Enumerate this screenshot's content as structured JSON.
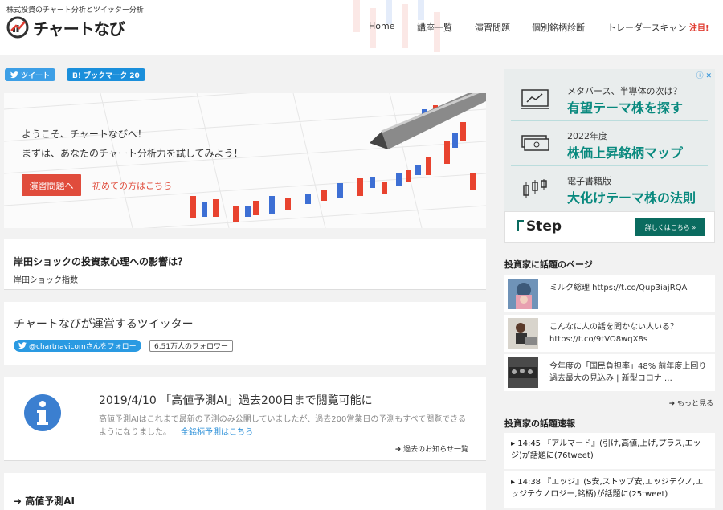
{
  "site": {
    "tagline": "株式投資のチャート分析とツイッター分析",
    "name": "チャートなび"
  },
  "nav": [
    "Home",
    "講座一覧",
    "演習問題",
    "個別銘柄診断",
    "トレーダースキャン"
  ],
  "nav_hot": "注目!",
  "share": {
    "tweet": "ツイート",
    "bookmark": "B! ブックマーク 20"
  },
  "hero": {
    "line1": "ようこそ、チャートなびへ！",
    "line2": "まずは、あなたのチャート分析力を試してみよう！",
    "cta": "演習問題へ",
    "link": "初めての方はこちら"
  },
  "card_kishida": {
    "title": "岸田ショックの投資家心理への影響は？",
    "link": "岸田ショック指数"
  },
  "card_twitter": {
    "title": "チャートなびが運営するツイッター",
    "follow": "@chartnavicomさんをフォロー",
    "followers": "6.51万人のフォロワー"
  },
  "notice": {
    "title": "2019/4/10 「高値予測AI」過去200日まで閲覧可能に",
    "body": "高値予測AIはこれまで最新の予測のみ公開していましたが、過去200営業日の予測もすべて閲覧できるようになりました。",
    "link": "全銘柄予測はこちら",
    "more": "過去のお知らせ一覧"
  },
  "section_ai": "高値予測AI",
  "ad": {
    "rows": [
      {
        "l1": "メタバース、半導体の次は？",
        "l2": "有望テーマ株を探す",
        "icon": "monitor-chart-icon"
      },
      {
        "l1": "2022年度",
        "l2": "株価上昇銘柄マップ",
        "icon": "money-stack-icon"
      },
      {
        "l1": "電子書籍版",
        "l2": "大化けテーマ株の法則",
        "icon": "candlestick-icon"
      }
    ],
    "brand": "Step",
    "button": "詳しくはこちら »",
    "colors": {
      "accent": "#08897e",
      "button": "#0a6b5f"
    }
  },
  "topics": {
    "heading": "投資家に話題のページ",
    "items": [
      {
        "text": "ミルク総理 https://t.co/Qup3iajRQA"
      },
      {
        "text": "こんなに人の話を聞かない人いる？ https://t.co/9tVO8wqX8s"
      },
      {
        "text": "今年度の「国民負担率」48% 前年度上回り過去最大の見込み | 新型コロナ …"
      }
    ],
    "more": "もっと見る"
  },
  "breaking": {
    "heading": "投資家の話題速報",
    "items": [
      {
        "text": "14:45 『アルマード』(引け,高値,上げ,プラス,エッジ)が話題に(76tweet)"
      },
      {
        "text": "14:38 『エッジ』(S安,ストップ安,エッジテクノ,エッジテクノロジー,銘柄)が話題に(25tweet)"
      }
    ]
  }
}
